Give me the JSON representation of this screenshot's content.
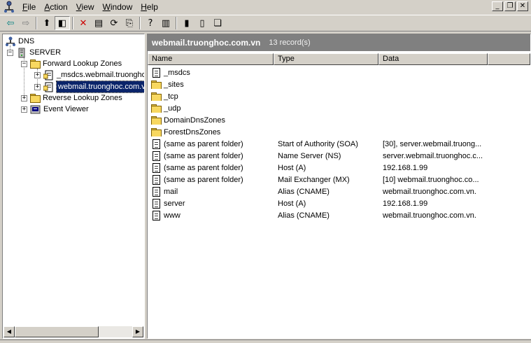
{
  "menu": {
    "items": [
      {
        "key": "F",
        "rest": "ile"
      },
      {
        "key": "A",
        "rest": "ction"
      },
      {
        "key": "V",
        "rest": "iew"
      },
      {
        "key": "W",
        "rest": "indow"
      },
      {
        "key": "H",
        "rest": "elp"
      }
    ]
  },
  "window_buttons": {
    "minimize": "_",
    "restore": "❐",
    "close": "✕"
  },
  "toolbar": {
    "buttons": [
      {
        "name": "back",
        "icon": "arrow-left-icon",
        "glyph": "⇦",
        "color": "#008080"
      },
      {
        "name": "forward",
        "icon": "arrow-right-icon",
        "glyph": "⇨",
        "color": "#808080"
      },
      {
        "name": "up-one-level",
        "icon": "folder-up-icon",
        "glyph": "⬆"
      },
      {
        "name": "show-hide-tree",
        "icon": "console-tree-icon",
        "glyph": "◧",
        "pressed": true
      },
      {
        "name": "delete",
        "icon": "delete-icon",
        "glyph": "✕",
        "color": "#cc0000"
      },
      {
        "name": "properties",
        "icon": "properties-icon",
        "glyph": "▤"
      },
      {
        "name": "refresh",
        "icon": "refresh-icon",
        "glyph": "⟳"
      },
      {
        "name": "export-list",
        "icon": "export-icon",
        "glyph": "⎘"
      },
      {
        "name": "help",
        "icon": "help-icon",
        "glyph": "?"
      },
      {
        "name": "action-pane",
        "icon": "pane-icon",
        "glyph": "▥"
      },
      {
        "name": "new-server",
        "icon": "server-icon",
        "glyph": "▮"
      },
      {
        "name": "new-record",
        "icon": "record-icon",
        "glyph": "▯"
      },
      {
        "name": "new-domain",
        "icon": "domain-icon",
        "glyph": "❏"
      }
    ]
  },
  "tree": {
    "root": "DNS",
    "server": "SERVER",
    "forward": "Forward Lookup Zones",
    "zone1": "_msdcs.webmail.truonghoc",
    "zone2": "webmail.truonghoc.com.vn",
    "reverse": "Reverse Lookup Zones",
    "events": "Event Viewer"
  },
  "header": {
    "zone": "webmail.truonghoc.com.vn",
    "count": "13 record(s)"
  },
  "columns": {
    "name": "Name",
    "type": "Type",
    "data": "Data"
  },
  "records": [
    {
      "name": "_msdcs",
      "type": "",
      "data": "",
      "icon": "zone-folder"
    },
    {
      "name": "_sites",
      "type": "",
      "data": "",
      "icon": "folder"
    },
    {
      "name": "_tcp",
      "type": "",
      "data": "",
      "icon": "folder"
    },
    {
      "name": "_udp",
      "type": "",
      "data": "",
      "icon": "folder"
    },
    {
      "name": "DomainDnsZones",
      "type": "",
      "data": "",
      "icon": "folder"
    },
    {
      "name": "ForestDnsZones",
      "type": "",
      "data": "",
      "icon": "folder"
    },
    {
      "name": "(same as parent folder)",
      "type": "Start of Authority (SOA)",
      "data": "[30], server.webmail.truong...",
      "icon": "doc"
    },
    {
      "name": "(same as parent folder)",
      "type": "Name Server (NS)",
      "data": "server.webmail.truonghoc.c...",
      "icon": "doc"
    },
    {
      "name": "(same as parent folder)",
      "type": "Host (A)",
      "data": "192.168.1.99",
      "icon": "doc"
    },
    {
      "name": "(same as parent folder)",
      "type": "Mail Exchanger (MX)",
      "data": "[10]  webmail.truonghoc.co...",
      "icon": "doc"
    },
    {
      "name": "mail",
      "type": "Alias (CNAME)",
      "data": "webmail.truonghoc.com.vn.",
      "icon": "doc"
    },
    {
      "name": "server",
      "type": "Host (A)",
      "data": "192.168.1.99",
      "icon": "doc"
    },
    {
      "name": "www",
      "type": "Alias (CNAME)",
      "data": "webmail.truonghoc.com.vn.",
      "icon": "doc"
    }
  ],
  "scroll": {
    "left": "◀",
    "right": "▶"
  }
}
